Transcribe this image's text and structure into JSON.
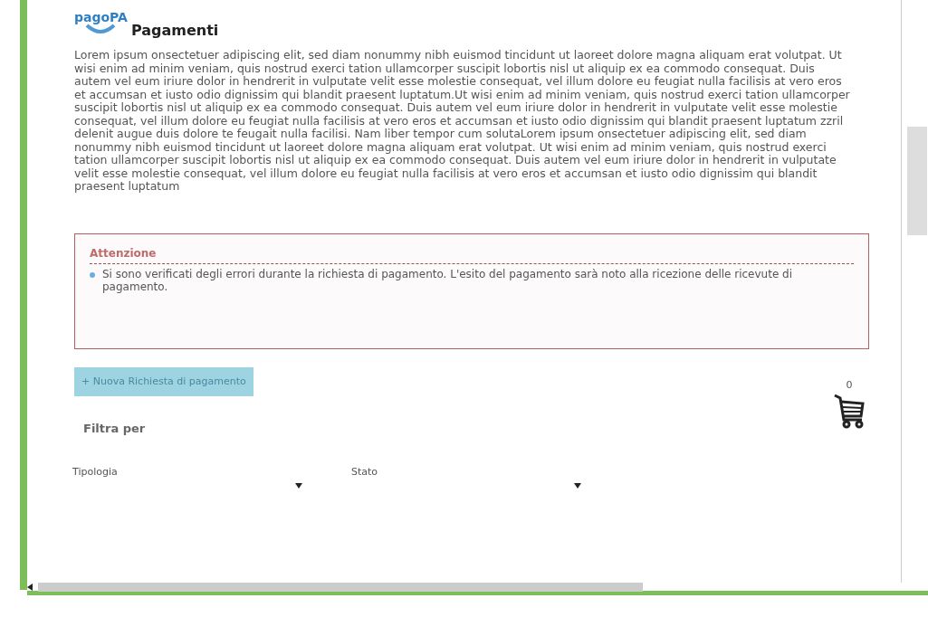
{
  "logo": {
    "text": "pagoPA"
  },
  "title": "Pagamenti",
  "intro": "Lorem ipsum onsectetuer adipiscing elit, sed diam nonummy nibh euismod tincidunt ut laoreet dolore magna aliquam erat volutpat. Ut wisi enim ad minim veniam, quis nostrud exerci tation ullamcorper suscipit lobortis nisl ut aliquip ex ea commodo consequat. Duis autem vel eum iriure dolor in hendrerit in vulputate velit esse molestie consequat, vel illum dolore eu feugiat nulla facilisis at vero eros et accumsan et iusto odio dignissim qui blandit praesent luptatum.Ut wisi enim ad minim veniam, quis nostrud exerci tation ullamcorper suscipit lobortis nisl ut aliquip ex ea commodo consequat. Duis autem vel eum iriure dolor in hendrerit in vulputate velit esse molestie consequat, vel illum dolore eu feugiat nulla facilisis at vero eros et accumsan et iusto odio dignissim qui blandit praesent luptatum zzril delenit augue duis dolore te feugait nulla facilisi. Nam liber tempor cum solutaLorem ipsum onsectetuer adipiscing elit, sed diam nonummy nibh euismod tincidunt ut laoreet dolore magna aliquam erat volutpat. Ut wisi enim ad minim veniam, quis nostrud exerci tation ullamcorper suscipit lobortis nisl ut aliquip ex ea commodo consequat. Duis autem vel eum iriure dolor in hendrerit in vulputate velit esse molestie consequat, vel illum dolore eu feugiat nulla facilisis at vero eros et accumsan et iusto odio dignissim qui blandit praesent luptatum",
  "alert": {
    "title": "Attenzione",
    "messages": [
      "Si sono verificati degli errori durante la richiesta di pagamento. L'esito del pagamento sarà noto alla ricezione delle ricevute di pagamento."
    ]
  },
  "new_request_button": "+ Nuova Richiesta di pagamento",
  "cart": {
    "count": "0"
  },
  "filter": {
    "title": "Filtra per",
    "fields": [
      {
        "label": "Tipologia"
      },
      {
        "label": "Stato"
      }
    ]
  }
}
